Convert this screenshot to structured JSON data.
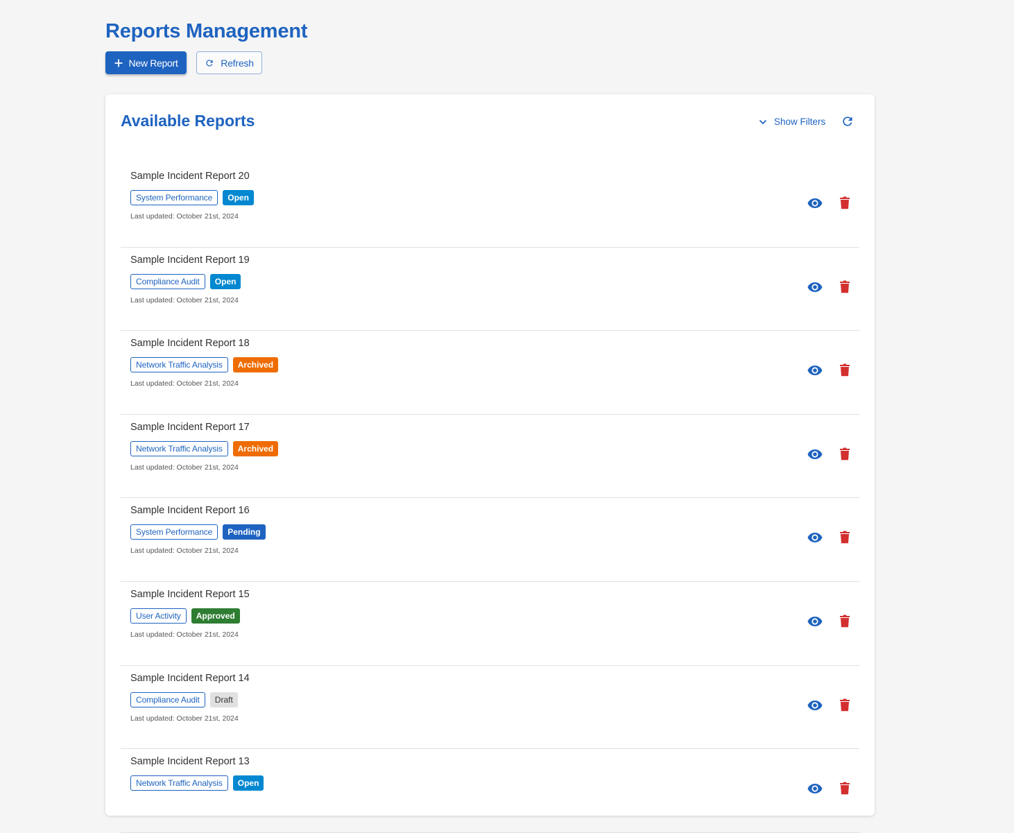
{
  "page": {
    "title": "Reports Management",
    "new_report_label": "New Report",
    "refresh_label": "Refresh"
  },
  "card": {
    "title": "Available Reports",
    "show_filters_label": "Show Filters"
  },
  "colors": {
    "primary": "#1e63c0",
    "danger": "#d32f2f",
    "status_open": "#0288d1",
    "status_archived": "#ef6c00",
    "status_pending": "#1e63c0",
    "status_approved": "#2e7d32",
    "status_draft": "#e0e0e0"
  },
  "icons": {
    "new_report": "plus-icon",
    "refresh": "refresh-icon",
    "show_filters": "chevron-down-icon",
    "view": "eye-icon",
    "delete": "trash-icon"
  },
  "reports": [
    {
      "title": "Sample Incident Report 20",
      "category": "System Performance",
      "status": "Open",
      "status_kind": "open",
      "updated": "Last updated: October 21st, 2024"
    },
    {
      "title": "Sample Incident Report 19",
      "category": "Compliance Audit",
      "status": "Open",
      "status_kind": "open",
      "updated": "Last updated: October 21st, 2024"
    },
    {
      "title": "Sample Incident Report 18",
      "category": "Network Traffic Analysis",
      "status": "Archived",
      "status_kind": "archived",
      "updated": "Last updated: October 21st, 2024"
    },
    {
      "title": "Sample Incident Report 17",
      "category": "Network Traffic Analysis",
      "status": "Archived",
      "status_kind": "archived",
      "updated": "Last updated: October 21st, 2024"
    },
    {
      "title": "Sample Incident Report 16",
      "category": "System Performance",
      "status": "Pending",
      "status_kind": "pending",
      "updated": "Last updated: October 21st, 2024"
    },
    {
      "title": "Sample Incident Report 15",
      "category": "User Activity",
      "status": "Approved",
      "status_kind": "approved",
      "updated": "Last updated: October 21st, 2024"
    },
    {
      "title": "Sample Incident Report 14",
      "category": "Compliance Audit",
      "status": "Draft",
      "status_kind": "draft",
      "updated": "Last updated: October 21st, 2024"
    },
    {
      "title": "Sample Incident Report 13",
      "category": "Network Traffic Analysis",
      "status": "Open",
      "status_kind": "open",
      "updated": ""
    }
  ]
}
